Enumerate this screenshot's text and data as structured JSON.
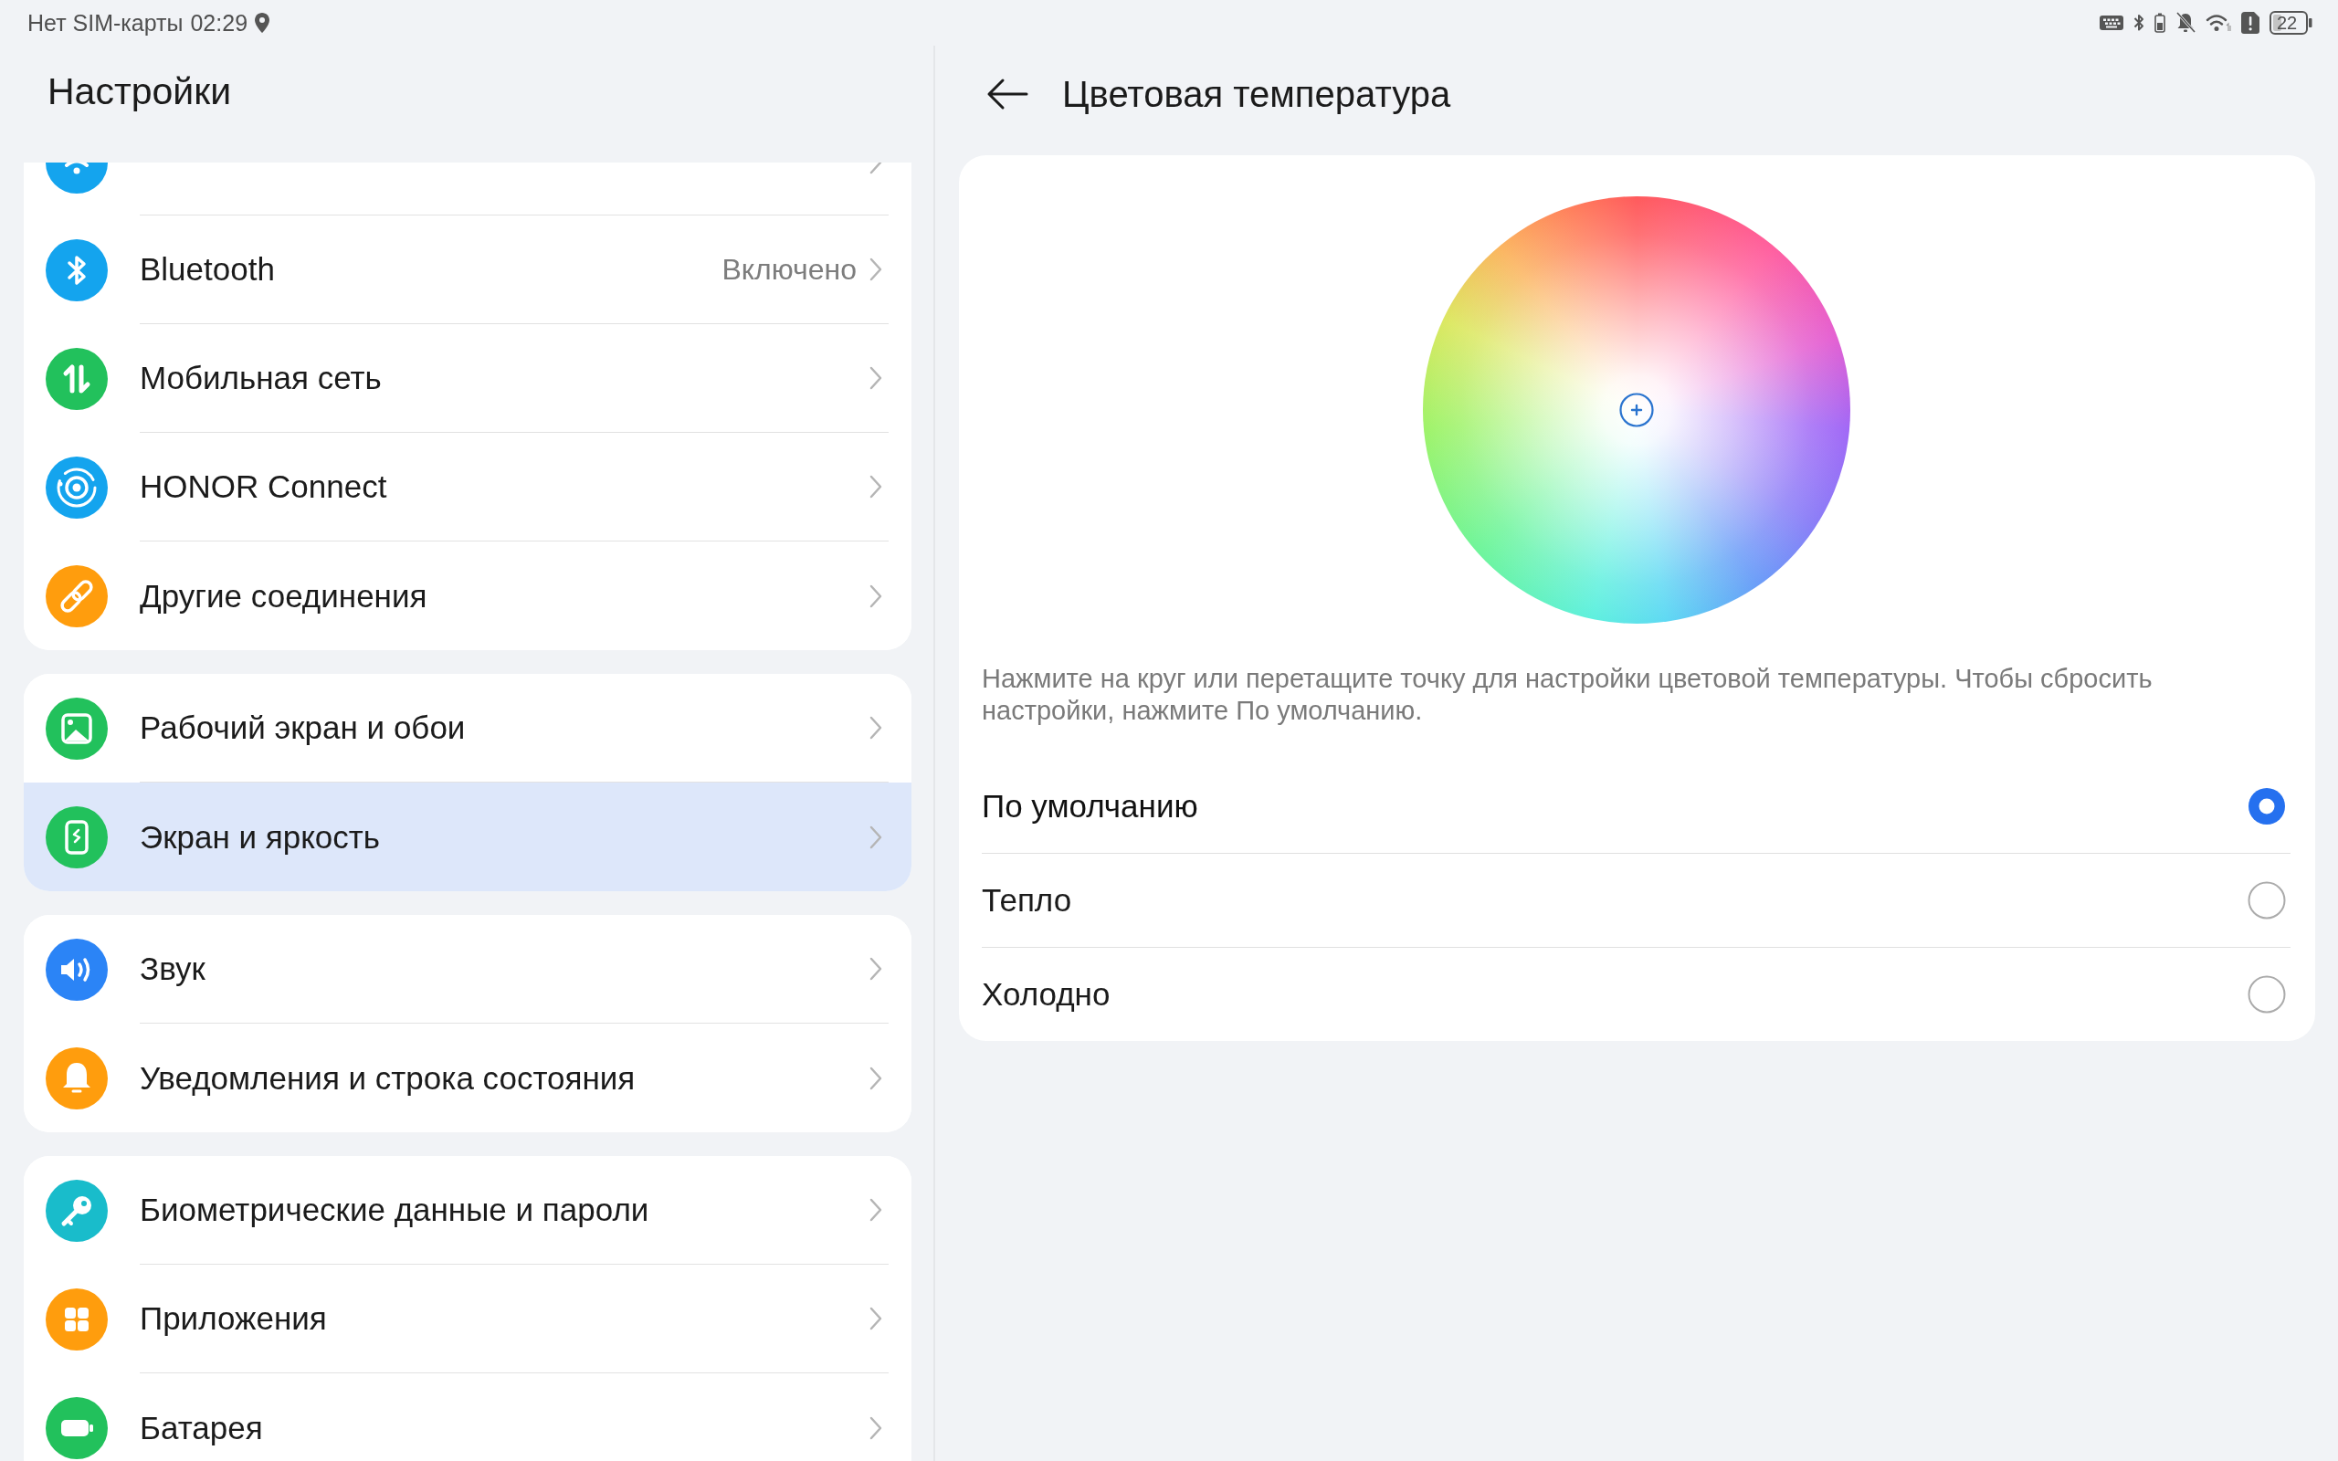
{
  "status_bar": {
    "carrier": "Нет SIM-карты",
    "time": "02:29",
    "battery": "22"
  },
  "sidebar": {
    "title": "Настройки",
    "groups": [
      {
        "items": [
          {
            "kind": "clipped",
            "color": "#14a4ee",
            "selected": false
          },
          {
            "kind": "row",
            "label": "Bluetooth",
            "value": "Включено",
            "color": "#14a4ee",
            "selected": false
          },
          {
            "kind": "row",
            "label": "Мобильная сеть",
            "color": "#22c15c",
            "selected": false
          },
          {
            "kind": "row",
            "label": "HONOR Connect",
            "color": "#14a4ee",
            "selected": false
          },
          {
            "kind": "row",
            "label": "Другие соединения",
            "color": "#ff9d0d",
            "selected": false
          }
        ]
      },
      {
        "items": [
          {
            "kind": "row",
            "label": "Рабочий экран и обои",
            "color": "#22c15c",
            "selected": false
          },
          {
            "kind": "row",
            "label": "Экран и яркость",
            "color": "#22c15c",
            "selected": true
          }
        ]
      },
      {
        "items": [
          {
            "kind": "row",
            "label": "Звук",
            "color": "#2b84f6",
            "selected": false
          },
          {
            "kind": "row",
            "label": "Уведомления и строка состояния",
            "color": "#ff9d0d",
            "selected": false
          }
        ]
      },
      {
        "items": [
          {
            "kind": "row",
            "label": "Биометрические данные и пароли",
            "color": "#19bccb",
            "selected": false
          },
          {
            "kind": "row",
            "label": "Приложения",
            "color": "#ff9d0d",
            "selected": false
          },
          {
            "kind": "row",
            "label": "Батарея",
            "color": "#22c15c",
            "selected": false
          }
        ]
      }
    ]
  },
  "page": {
    "title": "Цветовая температура",
    "description": "Нажмите на круг или перетащите точку для настройки цветовой температуры. Чтобы сбросить настройки, нажмите По умолчанию.",
    "options": [
      {
        "label": "По умолчанию",
        "selected": true
      },
      {
        "label": "Тепло",
        "selected": false
      },
      {
        "label": "Холодно",
        "selected": false
      }
    ]
  }
}
